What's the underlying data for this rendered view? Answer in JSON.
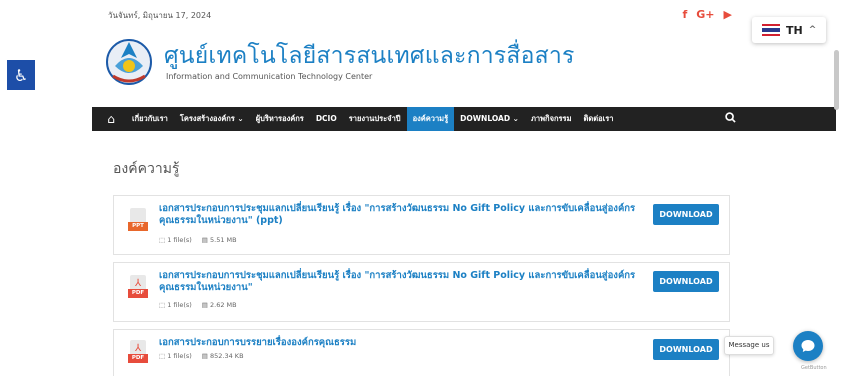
{
  "topbar": {
    "date": "วันจันทร์, มิถุนายน 17, 2024",
    "social": [
      {
        "icon": "facebook-icon",
        "glyph": "f"
      },
      {
        "icon": "google-plus-icon",
        "glyph": "G+"
      },
      {
        "icon": "youtube-icon",
        "glyph": "▶"
      }
    ]
  },
  "language": {
    "code": "TH",
    "chevron": "^"
  },
  "accessibility": {
    "icon": "accessibility-icon",
    "glyph": "♿"
  },
  "header": {
    "title": "ศูนย์เทคโนโลยีสารสนเทศและการสื่อสาร",
    "subtitle": "Information and Communication Technology Center"
  },
  "nav": {
    "home_glyph": "⌂",
    "items": [
      {
        "label": "เกี่ยวกับเรา"
      },
      {
        "label": "โครงสร้างองค์กร ⌄"
      },
      {
        "label": "ผู้บริหารองค์กร"
      },
      {
        "label": "DCIO"
      },
      {
        "label": "รายงานประจำปี"
      },
      {
        "label": "องค์ความรู้"
      },
      {
        "label": "DOWNLOAD ⌄"
      },
      {
        "label": "ภาพกิจกรรม"
      },
      {
        "label": "ติดต่อเรา"
      }
    ],
    "search_glyph": "🔍"
  },
  "page": {
    "heading": "องค์ความรู้"
  },
  "documents": [
    {
      "type": "PPT",
      "title": "เอกสารประกอบการประชุมแลกเปลี่ยนเรียนรู้ เรื่อง \"การสร้างวัฒนธรรม No Gift Policy และการขับเคลื่อนสู่องค์กรคุณธรรมในหน่วยงาน\" (ppt)",
      "files": "1 file(s)",
      "size": "5.51 MB",
      "button": "DOWNLOAD"
    },
    {
      "type": "PDF",
      "title": "เอกสารประกอบการประชุมแลกเปลี่ยนเรียนรู้ เรื่อง \"การสร้างวัฒนธรรม No Gift Policy และการขับเคลื่อนสู่องค์กรคุณธรรมในหน่วยงาน\"",
      "files": "1 file(s)",
      "size": "2.62 MB",
      "button": "DOWNLOAD"
    },
    {
      "type": "PDF",
      "title": "เอกสารประกอบการบรรยายเรื่ององค์กรคุณธรรม",
      "files": "1 file(s)",
      "size": "852.34 KB",
      "button": "DOWNLOAD"
    }
  ],
  "chat": {
    "tooltip": "Message us",
    "powered": "GetButton"
  },
  "colors": {
    "accent": "#1c80c4",
    "nav_bg": "#222222",
    "ppt": "#e8672b",
    "pdf": "#e74c3c"
  }
}
